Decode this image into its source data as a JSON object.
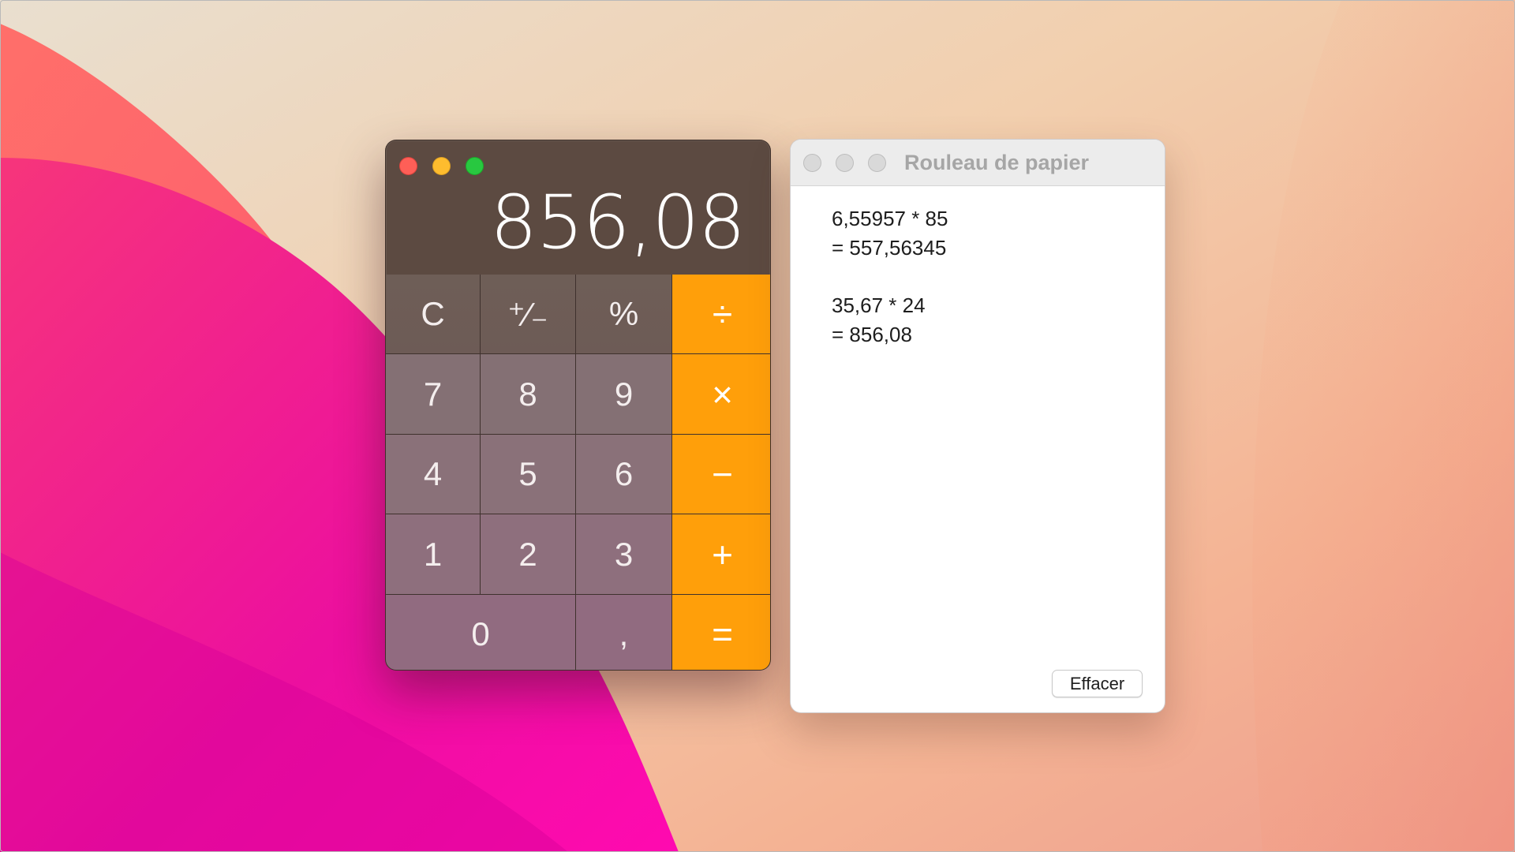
{
  "desktop": {
    "wallpaper_colors": [
      "#ff3a7a",
      "#e80aa7",
      "#f5b590",
      "#ece0cf"
    ]
  },
  "calculator": {
    "display_value": "856,08",
    "traffic_lights": {
      "close_color": "#fe5f57",
      "minimize_color": "#febc2e",
      "zoom_color": "#28c840"
    },
    "operator_color": "#ff9f0a",
    "keys": {
      "clear": "C",
      "sign": "⁺∕₋",
      "percent": "%",
      "divide": "÷",
      "seven": "7",
      "eight": "8",
      "nine": "9",
      "multiply": "×",
      "four": "4",
      "five": "5",
      "six": "6",
      "minus": "−",
      "one": "1",
      "two": "2",
      "three": "3",
      "plus": "+",
      "zero": "0",
      "decimal": ",",
      "equals": "="
    }
  },
  "paper_tape": {
    "title": "Rouleau de papier",
    "entries": [
      {
        "expression": "6,55957 * 85",
        "result": "= 557,56345"
      },
      {
        "expression": "35,67 * 24",
        "result": "= 856,08"
      }
    ],
    "clear_label": "Effacer"
  }
}
